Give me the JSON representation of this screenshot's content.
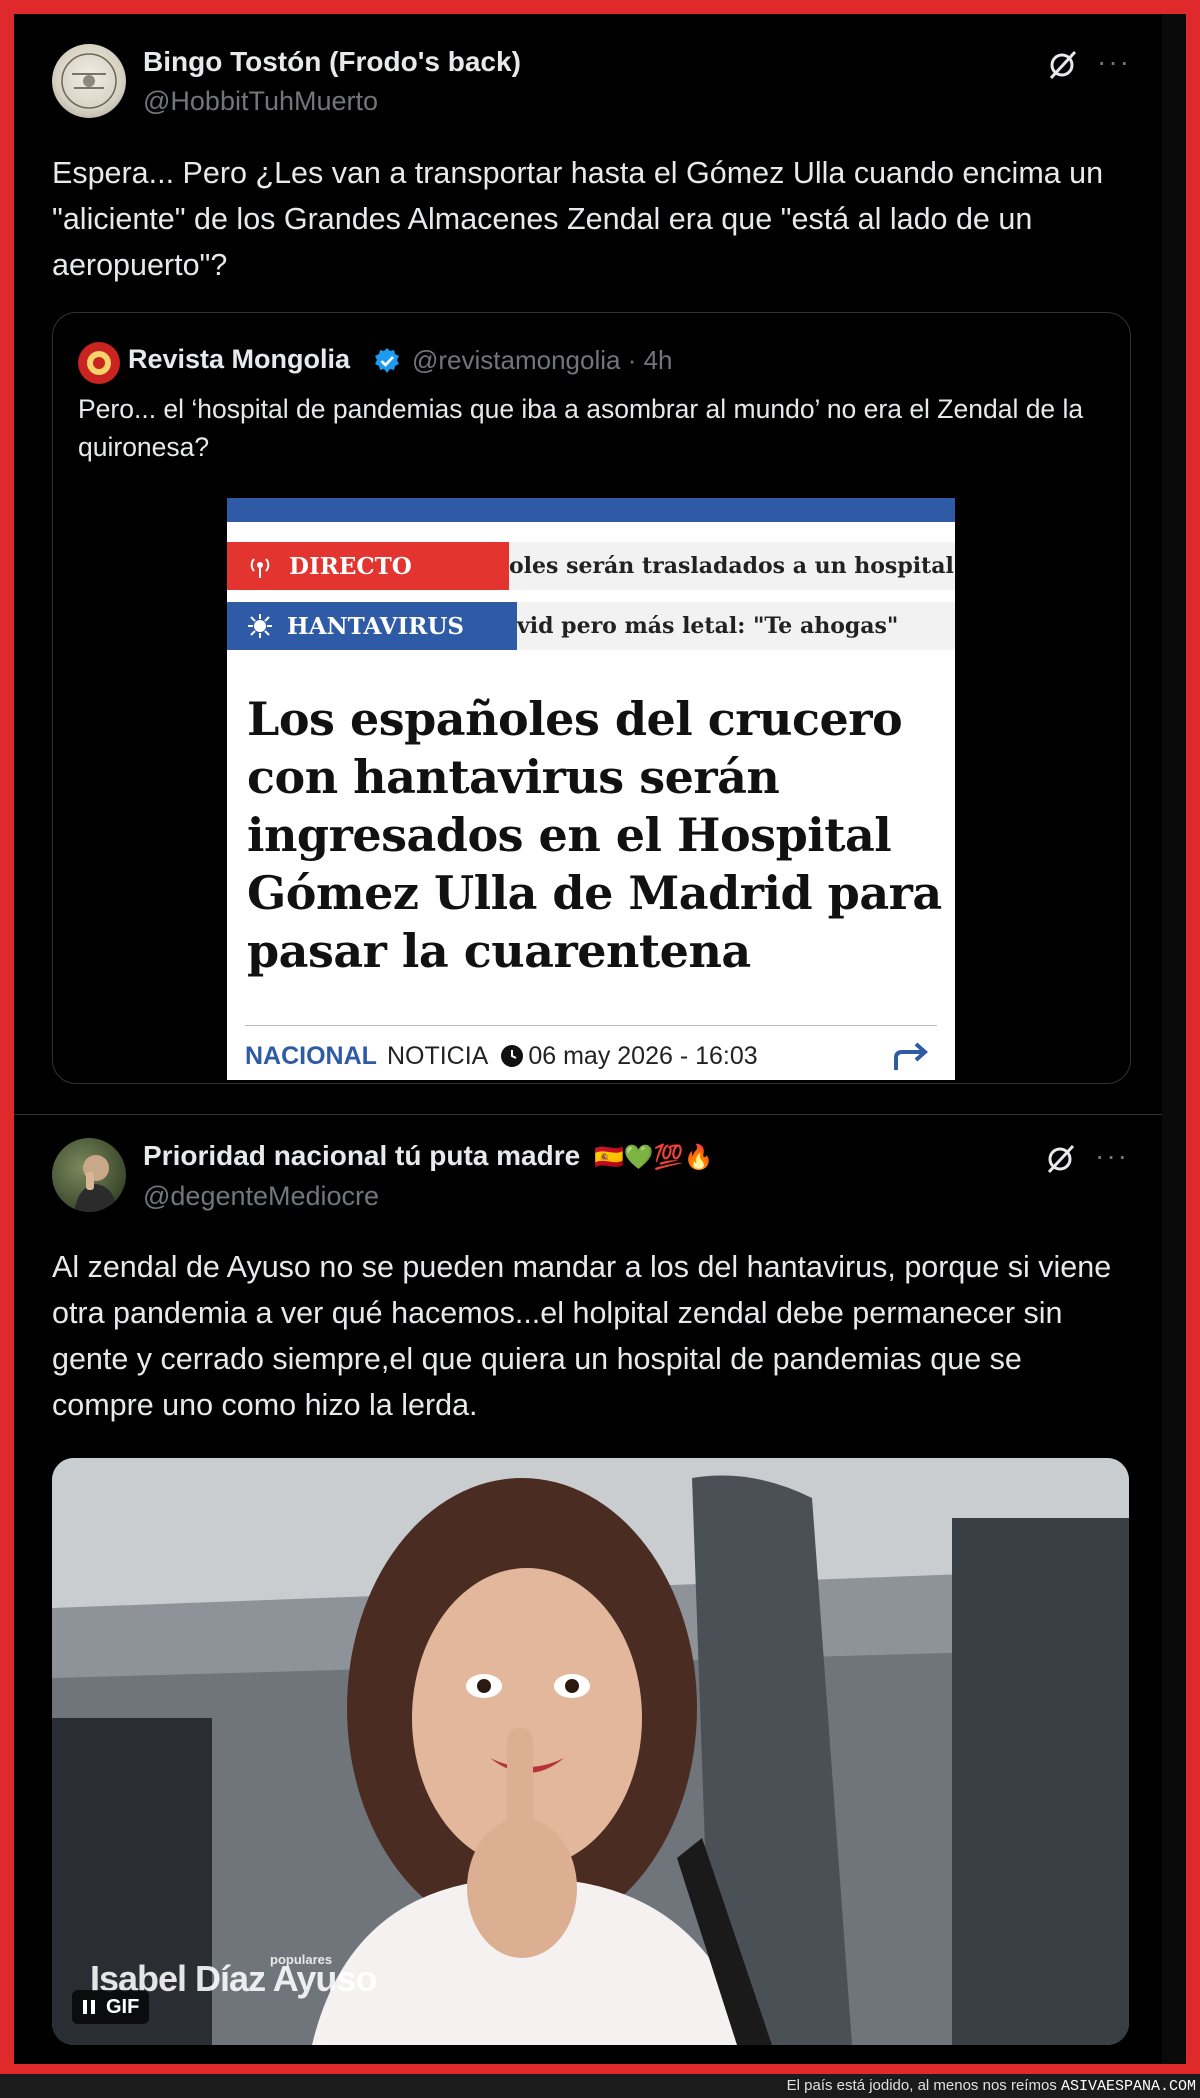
{
  "tweet1": {
    "author_name": "Bingo Tostón (Frodo's back)",
    "author_handle": "@HobbitTuhMuerto",
    "text": "Espera... Pero ¿Les van a transportar hasta el Gómez Ulla cuando encima un \"aliciente\" de los Grandes Almacenes Zendal era que \"está al lado de un aeropuerto\"?",
    "more_label": "···",
    "quote": {
      "author_name": "Revista Mongolia",
      "author_handle": "@revistamongolia",
      "time": "· 4h",
      "text": "Pero... el ‘hospital de pandemias que iba a asombrar al mundo’ no era el Zendal de la quironesa?",
      "news": {
        "tag1": "DIRECTO",
        "row1_text": "oles serán trasladados a un hospital de",
        "tag2": "HANTAVIRUS",
        "row2_text": "vid pero más letal: \"Te ahogas\"",
        "headline": "Los españoles del crucero con hantavirus serán ingresados en el Hospital Gómez Ulla de Madrid para pasar la cuarentena",
        "section": "NACIONAL",
        "kind": "NOTICIA",
        "date": "06 may 2026 - 16:03"
      }
    }
  },
  "tweet2": {
    "author_name": "Prioridad nacional tú puta madre",
    "author_emojis": "🇪🇸💚💯🔥",
    "author_handle": "@degenteMediocre",
    "text": "Al zendal de Ayuso no se pueden mandar a los del hantavirus, porque si viene otra pandemia a ver qué hacemos...el holpital zendal debe permanecer sin gente y cerrado siempre,el que quiera un hospital de pandemias que se compre uno como hizo la lerda.",
    "more_label": "···",
    "media": {
      "caption": "Isabel Díaz Ayuso",
      "small_tag": "populares",
      "badge_label": "GIF"
    }
  },
  "footer": {
    "text": "El país está jodido, al menos nos reímos",
    "brand": "ASIVAESPANA.COM"
  },
  "colors": {
    "frame": "#e0292a",
    "background": "#000000",
    "text_primary": "#e7e9ea",
    "text_secondary": "#71767b",
    "verified": "#1d9bf0",
    "news_red": "#e3342f",
    "news_blue": "#2f5ba6"
  }
}
